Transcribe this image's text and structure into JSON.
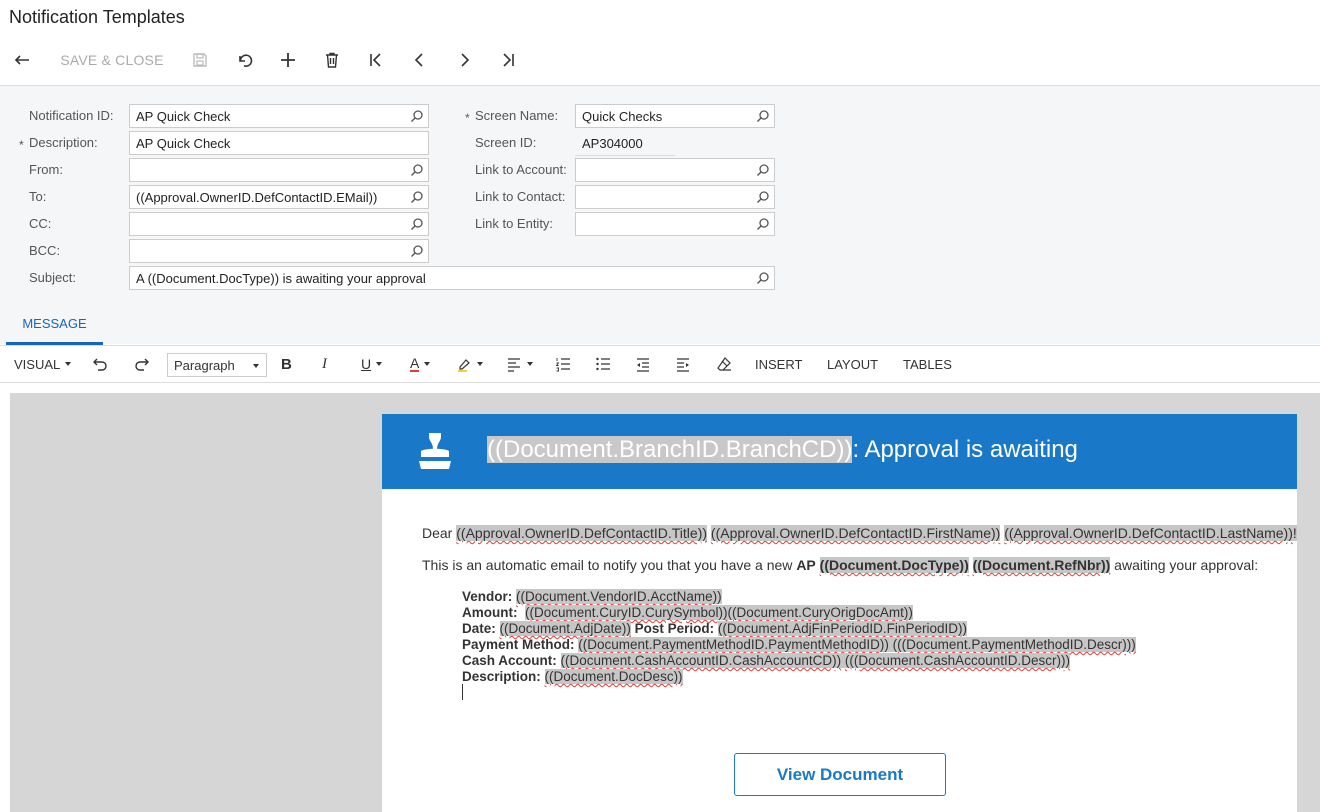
{
  "page": {
    "title": "Notification Templates"
  },
  "toolbar": {
    "save_close": "SAVE & CLOSE"
  },
  "form": {
    "notification_id": {
      "label": "Notification ID:",
      "value": "AP Quick Check"
    },
    "description": {
      "label": "Description:",
      "value": "AP Quick Check",
      "required": "*"
    },
    "from": {
      "label": "From:",
      "value": ""
    },
    "to": {
      "label": "To:",
      "value": "((Approval.OwnerID.DefContactID.EMail))"
    },
    "cc": {
      "label": "CC:",
      "value": ""
    },
    "bcc": {
      "label": "BCC:",
      "value": ""
    },
    "subject": {
      "label": "Subject:",
      "value": "A ((Document.DocType)) is awaiting your approval"
    },
    "screen_name": {
      "label": "Screen Name:",
      "value": "Quick Checks",
      "required": "*"
    },
    "screen_id": {
      "label": "Screen ID:",
      "value": "AP304000"
    },
    "link_account": {
      "label": "Link to Account:",
      "value": ""
    },
    "link_contact": {
      "label": "Link to Contact:",
      "value": ""
    },
    "link_entity": {
      "label": "Link to Entity:",
      "value": ""
    }
  },
  "tabs": {
    "message": "MESSAGE"
  },
  "editor_toolbar": {
    "visual": "VISUAL",
    "paragraph": "Paragraph",
    "insert": "INSERT",
    "layout": "LAYOUT",
    "tables": "TABLES",
    "bold": "B",
    "italic": "I",
    "underline": "U",
    "font_color": "A"
  },
  "email": {
    "header_field": "((Document.BranchID.BranchCD))",
    "header_suffix": ": Approval is awaiting",
    "dear": "Dear",
    "dear_title": "((Approval.OwnerID.DefContactID.Title))",
    "dear_first": "((Approval.OwnerID.DefContactID.FirstName))",
    "dear_last": "((Approval.OwnerID.DefContactID.LastName))",
    "dear_end": "!",
    "intro_prefix": "This is an automatic email to notify you that you have a new",
    "intro_ap": "AP",
    "intro_doctype": "((Document.DocType))",
    "intro_refnbr": "((Document.RefNbr))",
    "intro_suffix": "awaiting your approval:",
    "vendor_label": "Vendor:",
    "vendor_value": "((Document.VendorID.AcctName))",
    "amount_label": "Amount:",
    "amount_symbol": "((Document.CuryID.CurySymbol))",
    "amount_value": "((Document.CuryOrigDocAmt))",
    "date_label": "Date:",
    "date_value": "((Document.AdjDate))",
    "period_label": "Post Period:",
    "period_value": "((Document.AdjFinPeriodID.FinPeriodID))",
    "pm_label": "Payment Method:",
    "pm_value": "((Document.PaymentMethodID.PaymentMethodID))",
    "pm_descr": "(((Document.PaymentMethodID.Descr)))",
    "cash_label": "Cash Account:",
    "cash_value": "((Document.CashAccountID.CashAccountCD))",
    "cash_descr": "(((Document.CashAccountID.Descr)))",
    "desc_label": "Description:",
    "desc_value": "((Document.DocDesc))",
    "view_button": "View Document"
  }
}
